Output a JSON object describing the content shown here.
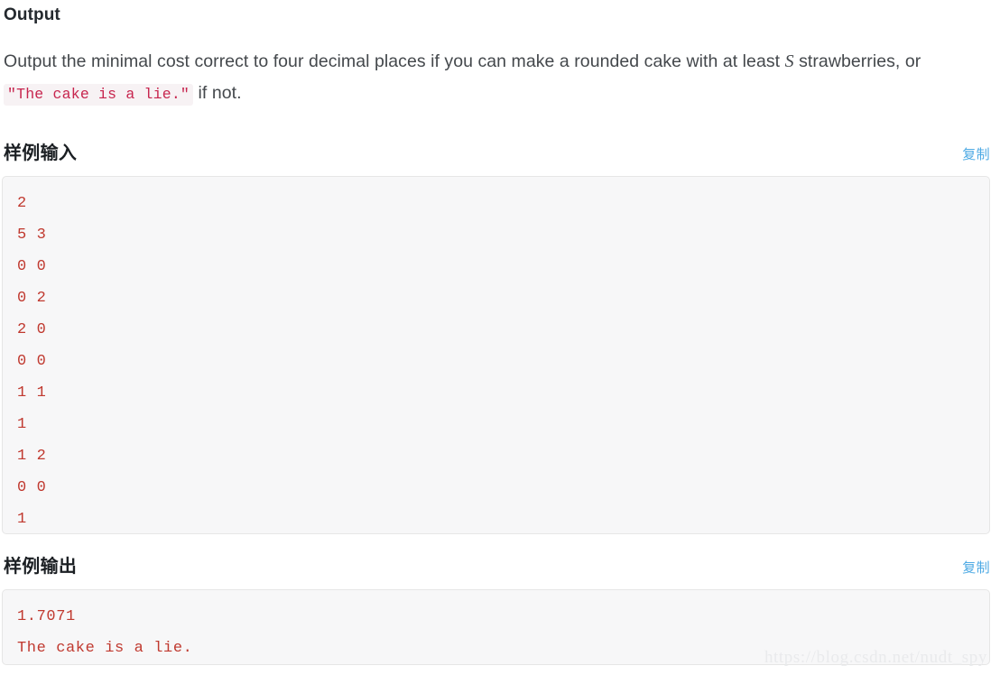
{
  "section": {
    "heading": "Output",
    "paragraph_part1": "Output the minimal cost correct to four decimal places if you can make a rounded cake with at least ",
    "math_symbol": "S",
    "paragraph_part2": " strawberries, or ",
    "inline_code": "\"The cake is a lie.\"",
    "paragraph_part3": " if not."
  },
  "sample_input": {
    "title": "样例输入",
    "copy_label": "复制",
    "code": "2\n5 3\n0 0\n0 2\n2 0\n0 0\n1 1\n1\n1 2\n0 0\n1"
  },
  "sample_output": {
    "title": "样例输出",
    "copy_label": "复制",
    "code": "1.7071\nThe cake is a lie."
  },
  "watermark": {
    "text": "https://blog.csdn.net/nudt_spy"
  },
  "colors": {
    "code_text": "#c0392f",
    "inline_code_text": "#c7254e",
    "copy_link": "#4eaae4",
    "body_text": "#44484c",
    "code_background": "#f7f7f8",
    "code_border": "#e6e6e6",
    "page_background": "#ffffff",
    "watermark": "#e9eaec"
  }
}
